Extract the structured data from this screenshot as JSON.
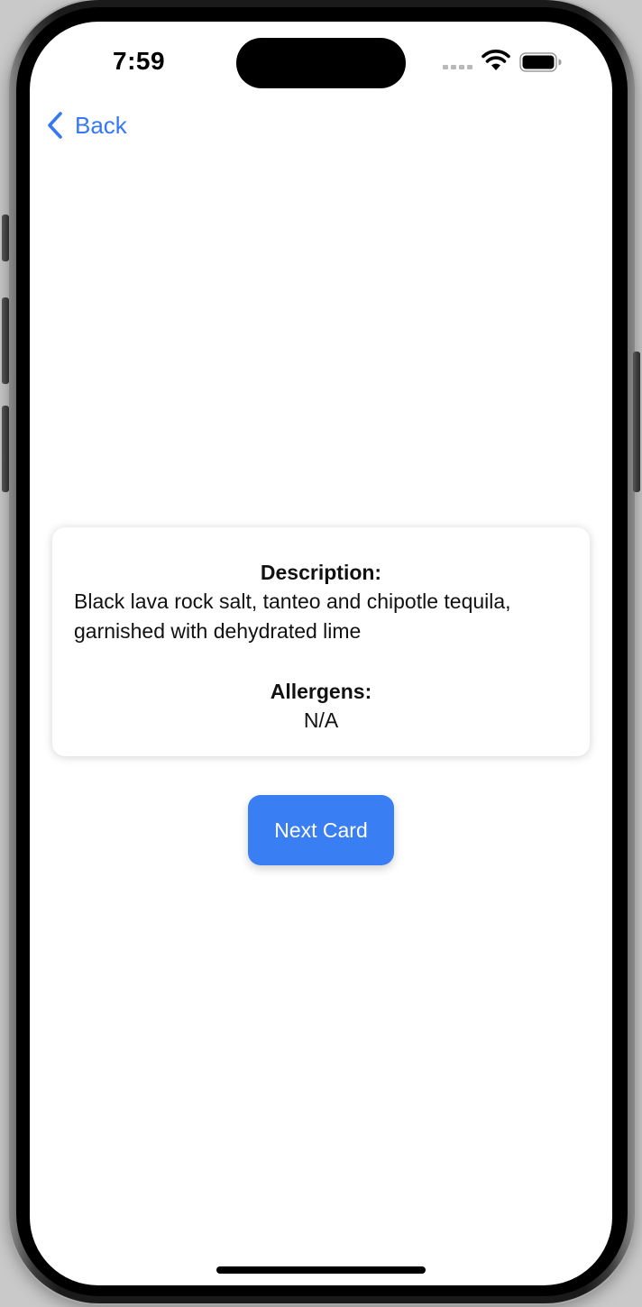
{
  "status_bar": {
    "time": "7:59"
  },
  "nav": {
    "back_label": "Back"
  },
  "card": {
    "description_label": "Description:",
    "description_text": "Black lava rock salt, tanteo and chipotle tequila, garnished with dehydrated lime",
    "allergens_label": "Allergens:",
    "allergens_text": "N/A"
  },
  "actions": {
    "next_card_label": "Next Card"
  },
  "colors": {
    "accent": "#3478f6",
    "button_background": "#3a7ef3",
    "screen_background": "#ffffff"
  },
  "icons": {
    "back": "chevron-left-icon",
    "signal": "cellular-signal-icon",
    "wifi": "wifi-icon",
    "battery": "battery-icon"
  }
}
